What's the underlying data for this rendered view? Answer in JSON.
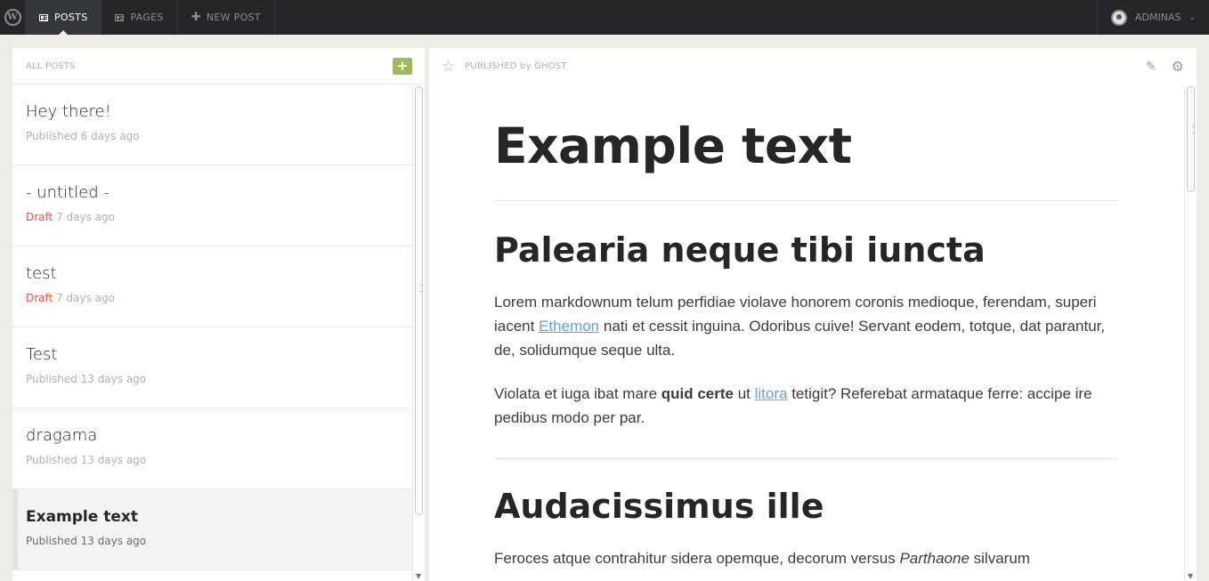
{
  "topbar": {
    "logo_text": "W",
    "nav": [
      {
        "label": "POSTS",
        "icon": "posts-icon",
        "active": true
      },
      {
        "label": "PAGES",
        "icon": "pages-icon",
        "active": false
      },
      {
        "label": "NEW POST",
        "icon": "plus-icon",
        "active": false
      }
    ],
    "user": {
      "name": "ADMINAS",
      "icon": "avatar-icon"
    }
  },
  "left_panel": {
    "title": "ALL POSTS",
    "add_label": "+",
    "posts": [
      {
        "title": "Hey there!",
        "status": "Published",
        "time": "6 days ago",
        "draft": false
      },
      {
        "title": "- untitled -",
        "status": "Draft",
        "time": "7 days ago",
        "draft": true
      },
      {
        "title": "test",
        "status": "Draft",
        "time": "7 days ago",
        "draft": true
      },
      {
        "title": "Test",
        "status": "Published",
        "time": "13 days ago",
        "draft": false
      },
      {
        "title": "dragama",
        "status": "Published",
        "time": "13 days ago",
        "draft": false
      },
      {
        "title": "Example text",
        "status": "Published",
        "time": "13 days ago",
        "draft": false,
        "selected": true
      }
    ]
  },
  "right_panel": {
    "status": "PUBLISHED by GHOST",
    "article": {
      "title": "Example text",
      "h2_1": "Palearia neque tibi iuncta",
      "p1_a": "Lorem markdownum telum perfidiae violave honorem coronis medioque, ferendam, superi iacent ",
      "p1_link": "Ethemon",
      "p1_b": " nati et cessit inguina. Odoribus cuive! Servant eodem, totque, dat parantur, de, solidumque seque ulta.",
      "p2_a": "Violata et iuga ibat mare ",
      "p2_bold": "quid certe",
      "p2_b": " ut ",
      "p2_link": "litora",
      "p2_c": " tetigit? Referebat armataque ferre: accipe ire pedibus modo per par.",
      "h2_2": "Audacissimus ille",
      "p3_a": "Feroces atque contrahitur sidera opemque, decorum versus ",
      "p3_italic": "Parthaone",
      "p3_b": " silvarum"
    }
  },
  "colors": {
    "topbar": "#242628",
    "background": "#edece6",
    "add_button": "#9fbb58",
    "draft": "#e25440",
    "link": "#5ba4e5"
  }
}
